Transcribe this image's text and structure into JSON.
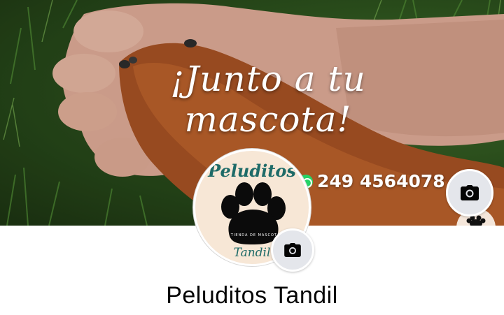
{
  "cover": {
    "headline": "¡Junto a tu mascota!",
    "phone": "249 4564078",
    "icons": {
      "contact": "whatsapp-icon",
      "edit": "camera-icon"
    }
  },
  "profile": {
    "logo_top": "Peluditos",
    "logo_tag": "TIENDA DE MASCOTAS",
    "logo_bottom": "Tandil",
    "edit_icon": "camera-icon",
    "name": "Peluditos Tandil"
  },
  "colors": {
    "logo_teal": "#1e6b68",
    "logo_bg": "#f7e7d6",
    "camera_button": "#e4e6eb",
    "whatsapp": "#25d366"
  }
}
